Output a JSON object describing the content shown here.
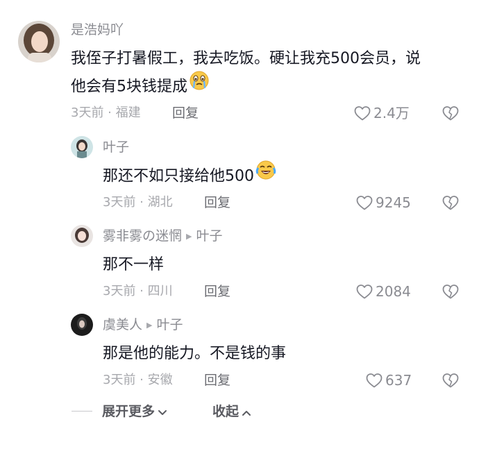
{
  "comments": [
    {
      "username": "是浩妈吖",
      "text_line1": "我侄子打暑假工，我去吃饭。硬让我充500会员，说",
      "text_line2": "他会有5块钱提成",
      "emoji_icon": "crying-face-emoji",
      "meta": "3天前 · 福建",
      "reply_label": "回复",
      "likes": "2.4万"
    },
    {
      "username": "叶子",
      "text": "那还不如只接给他500",
      "emoji_icon": "tears-of-joy-emoji",
      "meta": "3天前 · 湖北",
      "reply_label": "回复",
      "likes": "9245"
    },
    {
      "username": "雾非雾の迷惘",
      "reply_to": "叶子",
      "text": "那不一样",
      "meta": "3天前 · 四川",
      "reply_label": "回复",
      "likes": "2084"
    },
    {
      "username": "虞美人",
      "reply_to": "叶子",
      "text": "那是他的能力。不是钱的事",
      "meta": "3天前 · 安徽",
      "reply_label": "回复",
      "likes": "637"
    }
  ],
  "footer": {
    "expand_label": "展开更多",
    "collapse_label": "收起"
  },
  "colors": {
    "text_primary": "#161823",
    "text_secondary": "#8a8b91",
    "text_meta": "#a7a8ad",
    "background": "#ffffff"
  }
}
